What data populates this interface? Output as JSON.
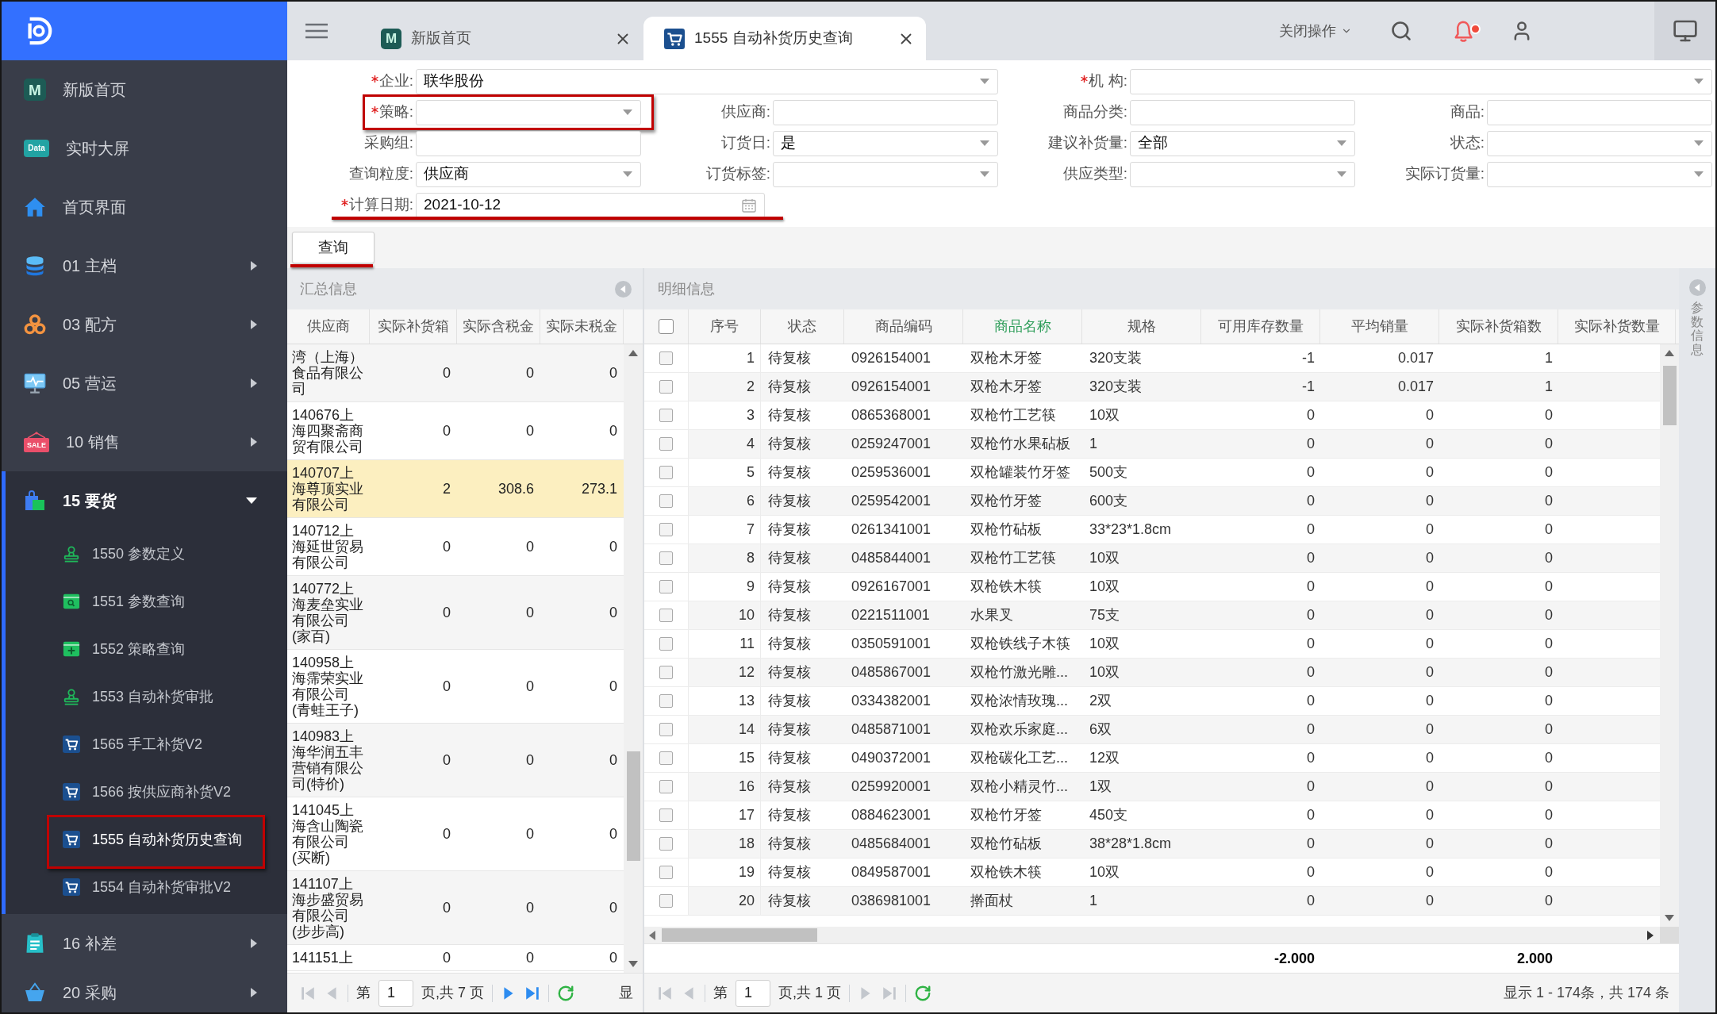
{
  "sidebar": {
    "items": [
      {
        "kind": "link",
        "label": "新版首页",
        "icon_text": "M"
      },
      {
        "kind": "link",
        "label": "实时大屏",
        "icon_text": "Data"
      },
      {
        "kind": "link",
        "label": "首页界面"
      },
      {
        "kind": "group",
        "label": "01 主档",
        "expanded": false
      },
      {
        "kind": "group",
        "label": "03 配方",
        "expanded": false
      },
      {
        "kind": "group",
        "label": "05 营运",
        "expanded": false
      },
      {
        "kind": "group",
        "label": "10 销售",
        "expanded": false,
        "icon_text": "SALE"
      },
      {
        "kind": "group",
        "label": "15 要货",
        "expanded": true,
        "children": [
          {
            "label": "1550 参数定义",
            "selected": false,
            "annotated": false
          },
          {
            "label": "1551 参数查询",
            "selected": false,
            "annotated": false
          },
          {
            "label": "1552 策略查询",
            "selected": false,
            "annotated": false
          },
          {
            "label": "1553 自动补货审批",
            "selected": false,
            "annotated": false
          },
          {
            "label": "1565 手工补货V2",
            "selected": false,
            "annotated": false
          },
          {
            "label": "1566 按供应商补货V2",
            "selected": false,
            "annotated": false
          },
          {
            "label": "1555 自动补货历史查询",
            "selected": true,
            "annotated": true
          },
          {
            "label": "1554 自动补货审批V2",
            "selected": false,
            "annotated": false
          }
        ]
      },
      {
        "kind": "group",
        "label": "16 补差",
        "expanded": false
      },
      {
        "kind": "group",
        "label": "20 采购",
        "expanded": false
      }
    ]
  },
  "topbar": {
    "tabs": [
      {
        "label": "新版首页",
        "icon_text": "M",
        "selected": false
      },
      {
        "label": "1555 自动补货历史查询",
        "selected": true
      }
    ],
    "close_menu": "关闭操作",
    "notification": true
  },
  "filters": {
    "rows": [
      [
        {
          "label": "企业:",
          "required": true,
          "kind": "select",
          "value": "联华股份",
          "framed": false,
          "underlined": false
        },
        "",
        {
          "label": "机 构:",
          "required": true,
          "kind": "select",
          "framed": false,
          "underlined": false
        },
        ""
      ],
      [
        {
          "label": "策略:",
          "required": true,
          "kind": "select",
          "framed": true,
          "underlined": false
        },
        {
          "label": "供应商:",
          "required": false,
          "kind": "input",
          "framed": false,
          "underlined": false
        },
        {
          "label": "商品分类:",
          "required": false,
          "kind": "input",
          "framed": false,
          "underlined": false
        },
        {
          "label": "商品:",
          "required": false,
          "kind": "input",
          "framed": false,
          "underlined": false
        }
      ],
      [
        {
          "label": "采购组:",
          "required": false,
          "kind": "input",
          "framed": false,
          "underlined": false
        },
        {
          "label": "订货日:",
          "required": false,
          "kind": "select",
          "value": "是",
          "framed": false,
          "underlined": false
        },
        {
          "label": "建议补货量:",
          "required": false,
          "kind": "select",
          "value": "全部",
          "framed": false,
          "underlined": false
        },
        {
          "label": "状态:",
          "required": false,
          "kind": "select",
          "framed": false,
          "underlined": false
        }
      ],
      [
        {
          "label": "查询粒度:",
          "required": false,
          "kind": "select",
          "value": "供应商",
          "framed": false,
          "underlined": false
        },
        {
          "label": "订货标签:",
          "required": false,
          "kind": "select",
          "framed": false,
          "underlined": false
        },
        {
          "label": "供应类型:",
          "required": false,
          "kind": "select",
          "framed": false,
          "underlined": false
        },
        {
          "label": "实际订货量:",
          "required": false,
          "kind": "select",
          "framed": false,
          "underlined": false
        }
      ],
      [
        {
          "label": "计算日期:",
          "required": true,
          "kind": "date",
          "value": "2021-10-12",
          "framed": false,
          "underlined": true
        }
      ]
    ],
    "query_button": {
      "label": "查询",
      "underlined": true
    }
  },
  "summary": {
    "title": "汇总信息",
    "columns": [
      "供应商",
      "实际补货箱",
      "实际含税金",
      "实际未税金"
    ],
    "rows": [
      {
        "cells": [
          "湾（上海）食品有限公司",
          "0",
          "0",
          "0"
        ],
        "selected": false
      },
      {
        "cells": [
          "140676上海四聚斋商贸有限公司",
          "0",
          "0",
          "0"
        ],
        "selected": false
      },
      {
        "cells": [
          "140707上海尊顶实业有限公司",
          "2",
          "308.6",
          "273.1"
        ],
        "selected": true
      },
      {
        "cells": [
          "140712上海延世贸易有限公司",
          "0",
          "0",
          "0"
        ],
        "selected": false
      },
      {
        "cells": [
          "140772上海麦垒实业有限公司(家百)",
          "0",
          "0",
          "0"
        ],
        "selected": false
      },
      {
        "cells": [
          "140958上海霈荣实业有限公司(青蛙王子)",
          "0",
          "0",
          "0"
        ],
        "selected": false
      },
      {
        "cells": [
          "140983上海华润五丰营销有限公司(特价)",
          "0",
          "0",
          "0"
        ],
        "selected": false
      },
      {
        "cells": [
          "141045上海含山陶瓷有限公司(买断)",
          "0",
          "0",
          "0"
        ],
        "selected": false
      },
      {
        "cells": [
          "141107上海步盛贸易有限公司(步步高)",
          "0",
          "0",
          "0"
        ],
        "selected": false
      },
      {
        "cells": [
          "141151上",
          "0",
          "0",
          "0"
        ],
        "selected": false
      }
    ],
    "pager": {
      "buttons": [
        {
          "kind": "first",
          "disabled": true
        },
        {
          "kind": "prev",
          "disabled": true
        },
        {
          "kind": "next",
          "disabled": false
        },
        {
          "kind": "last",
          "disabled": false
        }
      ],
      "page_label": "第",
      "page": "1",
      "page_total": "页,共 7 页",
      "info": "显"
    }
  },
  "detail": {
    "title": "明细信息",
    "select_all": {
      "checked": false
    },
    "columns": [
      {
        "label": "序号",
        "active": false
      },
      {
        "label": "状态",
        "active": false
      },
      {
        "label": "商品编码",
        "active": false
      },
      {
        "label": "商品名称",
        "active": true
      },
      {
        "label": "规格",
        "active": false
      },
      {
        "label": "可用库存数量",
        "active": false,
        "total": "-2.000"
      },
      {
        "label": "平均销量",
        "active": false
      },
      {
        "label": "实际补货箱数",
        "active": false,
        "total": "2.000"
      },
      {
        "label": "实际补货数量",
        "active": false
      }
    ],
    "rows": [
      {
        "checked": false,
        "cells": [
          "1",
          "待复核",
          "0926154001",
          "双枪木牙签",
          "320支装",
          "-1",
          "0.017",
          "1"
        ]
      },
      {
        "checked": false,
        "cells": [
          "2",
          "待复核",
          "0926154001",
          "双枪木牙签",
          "320支装",
          "-1",
          "0.017",
          "1"
        ]
      },
      {
        "checked": false,
        "cells": [
          "3",
          "待复核",
          "0865368001",
          "双枪竹工艺筷",
          "10双",
          "0",
          "0",
          "0"
        ]
      },
      {
        "checked": false,
        "cells": [
          "4",
          "待复核",
          "0259247001",
          "双枪竹水果砧板",
          "1",
          "0",
          "0",
          "0"
        ]
      },
      {
        "checked": false,
        "cells": [
          "5",
          "待复核",
          "0259536001",
          "双枪罐装竹牙签",
          "500支",
          "0",
          "0",
          "0"
        ]
      },
      {
        "checked": false,
        "cells": [
          "6",
          "待复核",
          "0259542001",
          "双枪竹牙签",
          "600支",
          "0",
          "0",
          "0"
        ]
      },
      {
        "checked": false,
        "cells": [
          "7",
          "待复核",
          "0261341001",
          "双枪竹砧板",
          "33*23*1.8cm",
          "0",
          "0",
          "0"
        ]
      },
      {
        "checked": false,
        "cells": [
          "8",
          "待复核",
          "0485844001",
          "双枪竹工艺筷",
          "10双",
          "0",
          "0",
          "0"
        ]
      },
      {
        "checked": false,
        "cells": [
          "9",
          "待复核",
          "0926167001",
          "双枪铁木筷",
          "10双",
          "0",
          "0",
          "0"
        ]
      },
      {
        "checked": false,
        "cells": [
          "10",
          "待复核",
          "0221511001",
          "水果叉",
          "75支",
          "0",
          "0",
          "0"
        ]
      },
      {
        "checked": false,
        "cells": [
          "11",
          "待复核",
          "0350591001",
          "双枪铁线子木筷",
          "10双",
          "0",
          "0",
          "0"
        ]
      },
      {
        "checked": false,
        "cells": [
          "12",
          "待复核",
          "0485867001",
          "双枪竹激光雕...",
          "10双",
          "0",
          "0",
          "0"
        ]
      },
      {
        "checked": false,
        "cells": [
          "13",
          "待复核",
          "0334382001",
          "双枪浓情玫瑰...",
          "2双",
          "0",
          "0",
          "0"
        ]
      },
      {
        "checked": false,
        "cells": [
          "14",
          "待复核",
          "0485871001",
          "双枪欢乐家庭...",
          "6双",
          "0",
          "0",
          "0"
        ]
      },
      {
        "checked": false,
        "cells": [
          "15",
          "待复核",
          "0490372001",
          "双枪碳化工艺...",
          "12双",
          "0",
          "0",
          "0"
        ]
      },
      {
        "checked": false,
        "cells": [
          "16",
          "待复核",
          "0259920001",
          "双枪小精灵竹...",
          "1双",
          "0",
          "0",
          "0"
        ]
      },
      {
        "checked": false,
        "cells": [
          "17",
          "待复核",
          "0884623001",
          "双枪竹牙签",
          "450支",
          "0",
          "0",
          "0"
        ]
      },
      {
        "checked": false,
        "cells": [
          "18",
          "待复核",
          "0485684001",
          "双枪竹砧板",
          "38*28*1.8cm",
          "0",
          "0",
          "0"
        ]
      },
      {
        "checked": false,
        "cells": [
          "19",
          "待复核",
          "0849587001",
          "双枪铁木筷",
          "10双",
          "0",
          "0",
          "0"
        ]
      },
      {
        "checked": false,
        "cells": [
          "20",
          "待复核",
          "0386981001",
          "擀面杖",
          "1",
          "0",
          "0",
          "0"
        ]
      }
    ],
    "pager": {
      "buttons": [
        {
          "kind": "first",
          "disabled": true
        },
        {
          "kind": "prev",
          "disabled": true
        },
        {
          "kind": "next",
          "disabled": true
        },
        {
          "kind": "last",
          "disabled": true
        }
      ],
      "page_label": "第",
      "page": "1",
      "page_total": "页,共 1 页",
      "info": "显示 1 - 174条，共 174 条"
    }
  },
  "side_panel": {
    "title": "参数信息"
  }
}
